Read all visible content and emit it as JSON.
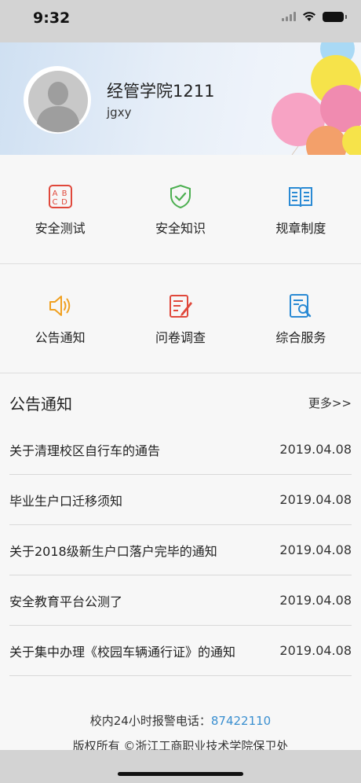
{
  "status_bar": {
    "time": "9:32"
  },
  "profile": {
    "name": "经管学院1211",
    "id": "jgxy"
  },
  "grid": {
    "row1": [
      {
        "label": "安全测试",
        "icon": "abcd-test-icon",
        "color": "#e0483b"
      },
      {
        "label": "安全知识",
        "icon": "shield-check-icon",
        "color": "#4caf50"
      },
      {
        "label": "规章制度",
        "icon": "book-icon",
        "color": "#2a8ad4"
      }
    ],
    "row2": [
      {
        "label": "公告通知",
        "icon": "speaker-icon",
        "color": "#f0a020"
      },
      {
        "label": "问卷调查",
        "icon": "survey-icon",
        "color": "#e0483b"
      },
      {
        "label": "综合服务",
        "icon": "search-document-icon",
        "color": "#2a8ad4"
      }
    ]
  },
  "notice": {
    "title": "公告通知",
    "more": "更多>>",
    "items": [
      {
        "title": "关于清理校区自行车的通告",
        "date": "2019.04.08"
      },
      {
        "title": "毕业生户口迁移须知",
        "date": "2019.04.08"
      },
      {
        "title": "关于2018级新生户口落户完毕的通知",
        "date": "2019.04.08"
      },
      {
        "title": "安全教育平台公测了",
        "date": "2019.04.08"
      },
      {
        "title": "关于集中办理《校园车辆通行证》的通知",
        "date": "2019.04.08"
      }
    ]
  },
  "footer": {
    "hotline_label": "校内24小时报警电话：",
    "hotline_number": "87422110",
    "copyright": "版权所有 ©浙江工商职业技术学院保卫处"
  }
}
